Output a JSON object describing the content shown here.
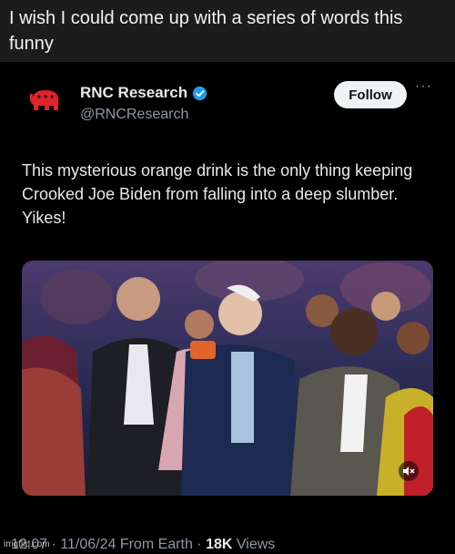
{
  "caption": {
    "text": "I wish I could come up with a series of words this funny"
  },
  "tweet": {
    "display_name": "RNC Research",
    "handle": "@RNCResearch",
    "follow_label": "Follow",
    "more_label": "···",
    "text": "This mysterious orange drink is the only thing keeping Crooked Joe Biden from falling into a deep slumber. Yikes!",
    "time": "12:07",
    "date": "11/06/24 From Earth",
    "separator": "·",
    "views_count": "18K",
    "views_label": "Views",
    "verified_color": "#1d9bf0",
    "logo_color": "#e0242a"
  },
  "watermark": {
    "text": "imgflip.com"
  }
}
